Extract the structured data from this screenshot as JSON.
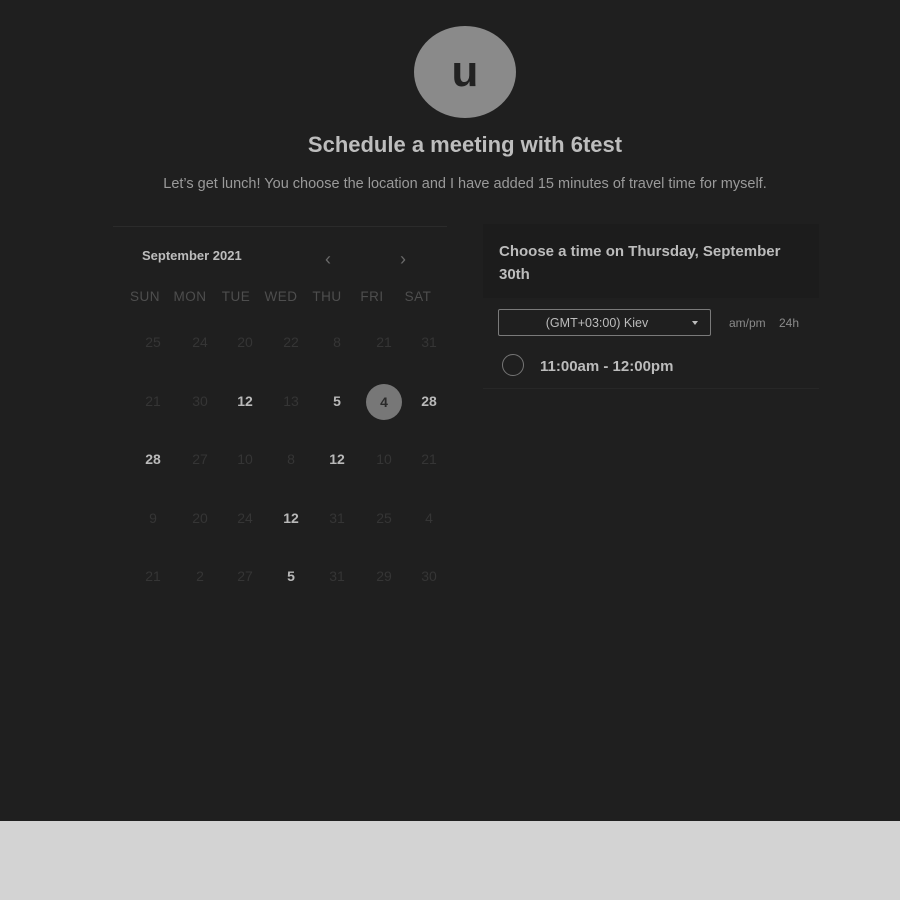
{
  "header": {
    "avatar_letter": "u",
    "title": "Schedule a meeting with 6test",
    "subtitle": "Let’s get lunch! You choose the location and I have added 15 minutes of travel time for myself."
  },
  "calendar": {
    "month_label": "September 2021",
    "prev_glyph": "‹",
    "next_glyph": "›",
    "weekdays": [
      "SUN",
      "MON",
      "TUE",
      "WED",
      "THU",
      "FRI",
      "SAT"
    ],
    "weeks": [
      [
        {
          "d": "25",
          "avail": false
        },
        {
          "d": "24",
          "avail": false
        },
        {
          "d": "20",
          "avail": false
        },
        {
          "d": "22",
          "avail": false
        },
        {
          "d": "8",
          "avail": false
        },
        {
          "d": "21",
          "avail": false
        },
        {
          "d": "31",
          "avail": false
        }
      ],
      [
        {
          "d": "21",
          "avail": false
        },
        {
          "d": "30",
          "avail": false
        },
        {
          "d": "12",
          "avail": true
        },
        {
          "d": "13",
          "avail": false
        },
        {
          "d": "5",
          "avail": true
        },
        {
          "d": "4",
          "avail": true,
          "selected": true
        },
        {
          "d": "28",
          "avail": true
        }
      ],
      [
        {
          "d": "28",
          "avail": true
        },
        {
          "d": "27",
          "avail": false
        },
        {
          "d": "10",
          "avail": false
        },
        {
          "d": "8",
          "avail": false
        },
        {
          "d": "12",
          "avail": true
        },
        {
          "d": "10",
          "avail": false
        },
        {
          "d": "21",
          "avail": false
        }
      ],
      [
        {
          "d": "9",
          "avail": false
        },
        {
          "d": "20",
          "avail": false
        },
        {
          "d": "24",
          "avail": false
        },
        {
          "d": "12",
          "avail": true
        },
        {
          "d": "31",
          "avail": false
        },
        {
          "d": "25",
          "avail": false
        },
        {
          "d": "4",
          "avail": false
        }
      ],
      [
        {
          "d": "21",
          "avail": false
        },
        {
          "d": "2",
          "avail": false
        },
        {
          "d": "27",
          "avail": false
        },
        {
          "d": "5",
          "avail": true
        },
        {
          "d": "31",
          "avail": false
        },
        {
          "d": "29",
          "avail": false
        },
        {
          "d": "30",
          "avail": false
        }
      ]
    ]
  },
  "times": {
    "heading": "Choose a time on Thursday, September 30th",
    "timezone": "(GMT+03:00) Kiev",
    "format_ampm": "am/pm",
    "format_24h": "24h",
    "slots": [
      "11:00am - 12:00pm"
    ]
  },
  "colors": {
    "background": "#1f1f1f",
    "footer": "#d3d3d3",
    "selected_day": "#777777"
  }
}
